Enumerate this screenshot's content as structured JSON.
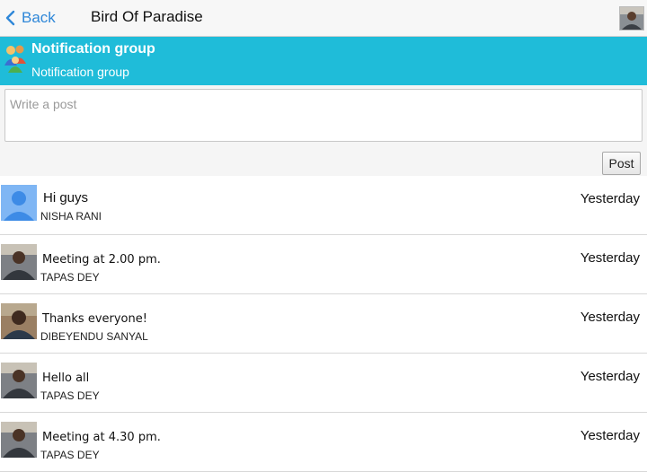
{
  "header": {
    "back_label": "Back",
    "title": "Bird Of Paradise"
  },
  "group": {
    "name": "Notification group",
    "description": "Notification group"
  },
  "composer": {
    "placeholder": "Write a post",
    "post_label": "Post"
  },
  "posts": [
    {
      "text": "Hi guys",
      "author": "NISHA RANI",
      "time": "Yesterday",
      "avatar": "default-person"
    },
    {
      "text": "Meeting at 2.00 pm.",
      "author": "TAPAS DEY",
      "time": "Yesterday",
      "avatar": "photo"
    },
    {
      "text": "Thanks everyone!",
      "author": "DIBEYENDU SANYAL",
      "time": "Yesterday",
      "avatar": "photo"
    },
    {
      "text": "Hello all",
      "author": "TAPAS DEY",
      "time": "Yesterday",
      "avatar": "photo"
    },
    {
      "text": "Meeting at 4.30 pm.",
      "author": "TAPAS DEY",
      "time": "Yesterday",
      "avatar": "photo"
    }
  ],
  "colors": {
    "accent": "#1fbcd9",
    "link": "#2f87d8"
  }
}
